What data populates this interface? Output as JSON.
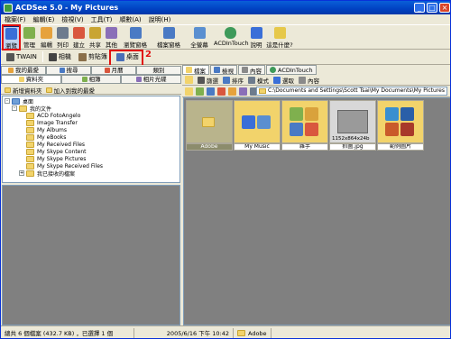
{
  "window": {
    "title": "ACDSee 5.0 - My Pictures",
    "min": "_",
    "max": "□",
    "close": "×"
  },
  "menu": [
    "檔案(F)",
    "編輯(E)",
    "檢視(V)",
    "工具(T)",
    "順數(A)",
    "說明(H)"
  ],
  "toolbar": {
    "buttons": [
      {
        "label": "瀏覽",
        "icon": "browse-icon",
        "color": "#3a6fd8"
      },
      {
        "label": "管理",
        "icon": "manage-icon",
        "color": "#7fb04e"
      },
      {
        "label": "編輯",
        "icon": "edit-icon",
        "color": "#e6a23c"
      },
      {
        "label": "列印",
        "icon": "print-icon",
        "color": "#6d7b8d"
      },
      {
        "label": "建立",
        "icon": "create-icon",
        "color": "#d9573e"
      },
      {
        "label": "共享",
        "icon": "share-icon",
        "color": "#c9a532"
      },
      {
        "label": "其他",
        "icon": "other-icon",
        "color": "#8a6fb8"
      }
    ],
    "right_buttons": [
      {
        "label": "瀏覽窗格",
        "icon": "browse-pane-icon"
      },
      {
        "label": "檔案窗格",
        "icon": "file-pane-icon"
      },
      {
        "label": "全螢幕",
        "icon": "fullscreen-icon"
      },
      {
        "label": "ACDInTouch",
        "icon": "acdintouch-icon"
      },
      {
        "label": "說明",
        "icon": "help-icon"
      },
      {
        "label": "這是什麼?",
        "icon": "whatsthis-icon"
      }
    ],
    "annotation_1": "1"
  },
  "toolbar2": {
    "twain": "TWAIN",
    "camera": "相機",
    "clipboard": "剪貼簿",
    "desktop": "桌面",
    "annotation_2": "2"
  },
  "left": {
    "tabs_row1": [
      "我的最愛",
      "搜尋",
      "月曆",
      "類別"
    ],
    "tabs_row2": [
      "資料夾",
      "相簿",
      "相片光碟"
    ],
    "fav_new": "新增資料夾",
    "fav_add": "加入到我的最愛",
    "tree": [
      {
        "label": "桌面",
        "level": 0,
        "pm": "-"
      },
      {
        "label": "我的文件",
        "level": 1,
        "pm": "-"
      },
      {
        "label": "ACD FotoAngelo",
        "level": 2,
        "pm": ""
      },
      {
        "label": "Image Transfer",
        "level": 2,
        "pm": ""
      },
      {
        "label": "My Albums",
        "level": 2,
        "pm": ""
      },
      {
        "label": "My eBooks",
        "level": 2,
        "pm": ""
      },
      {
        "label": "My Received Files",
        "level": 2,
        "pm": ""
      },
      {
        "label": "My Skype Content",
        "level": 2,
        "pm": ""
      },
      {
        "label": "My Skype Pictures",
        "level": 2,
        "pm": ""
      },
      {
        "label": "My Skype Received Files",
        "level": 2,
        "pm": ""
      },
      {
        "label": "我已接收的檔案",
        "level": 2,
        "pm": "+"
      }
    ]
  },
  "right": {
    "tabs": [
      "檔案",
      "檢視",
      "內容",
      "ACDInTouch"
    ],
    "sort": "排序",
    "filter": "篩選",
    "mode": "模式",
    "select": "選取",
    "content": "內容",
    "path": "C:\\Documents and Settings\\Scott Tsai\\My Documents\\My Pictures",
    "thumbs": [
      {
        "caption": "Adobe",
        "kind": "folder",
        "selected": true
      },
      {
        "caption": "My Music",
        "kind": "folder-mixed",
        "selected": false
      },
      {
        "caption": "雜手",
        "kind": "folder-mixed",
        "selected": false
      },
      {
        "caption": "抓圖.jpg",
        "kind": "image",
        "selected": false,
        "overlay": "1152x864x24b"
      },
      {
        "caption": "範例圖片",
        "kind": "folder-photos",
        "selected": false
      }
    ]
  },
  "status": {
    "count": "總共 6 個檔案 (432.7 KB) ，已選擇 1 個",
    "date": "2005/6/16 下午 10:42",
    "folder": "Adobe"
  },
  "colors": {
    "annotation": "#e01010",
    "titlebar": "#0141c2"
  }
}
